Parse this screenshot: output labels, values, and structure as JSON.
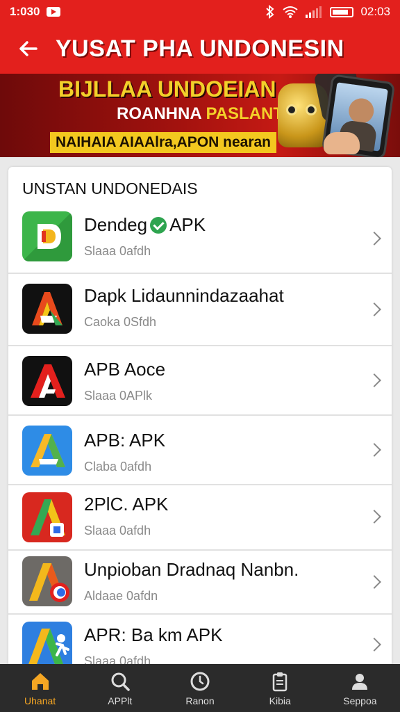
{
  "status_bar": {
    "time": "1:030",
    "clock": "02:03",
    "icons": [
      "youtube-icon",
      "bluetooth-icon",
      "wifi-icon",
      "signal-icon",
      "battery-icon"
    ]
  },
  "app_bar": {
    "title": "YUSAT PHA UNDONESIN",
    "back_icon": "arrow-left-icon"
  },
  "banner": {
    "headline": "BIJLLAA UNDOEIAN",
    "line2_white": "ROANHNA",
    "line2_yellow": "PASLANT",
    "strip": "NAIHAIA AIAAlra,APON nearan"
  },
  "section": {
    "title": "UNSTAN UNDONEDAIS"
  },
  "apps": [
    {
      "name": "Dendeg",
      "suffix": "APK",
      "verified": true,
      "subtitle": "Slaaa 0afdh",
      "icon": "green-d-app-icon"
    },
    {
      "name": "Dapk Lidaunnindazaahat",
      "suffix": "",
      "verified": false,
      "subtitle": "Caoka 0Sfdh",
      "icon": "black-multicolor-a-app-icon"
    },
    {
      "name": "APB Aoce",
      "suffix": "",
      "verified": false,
      "subtitle": "Slaaa 0APlk",
      "icon": "black-red-a-app-icon"
    },
    {
      "name": "APB: APK",
      "suffix": "",
      "verified": false,
      "subtitle": "Claba 0afdh",
      "icon": "blue-a-app-icon"
    },
    {
      "name": "2PlC. APK",
      "suffix": "",
      "verified": false,
      "subtitle": "Slaaa 0afdh",
      "icon": "red-green-a-app-icon"
    },
    {
      "name": "Unpioban Dradnaq Nanbn.",
      "suffix": "",
      "verified": false,
      "subtitle": "Aldaae 0afdn",
      "icon": "gray-yellow-a-app-icon"
    },
    {
      "name": "APR: Ba km APK",
      "suffix": "",
      "verified": false,
      "subtitle": "Slaaa 0afdh",
      "icon": "blue-a-runner-app-icon"
    }
  ],
  "bottom_nav": [
    {
      "label": "Uhanat",
      "icon": "home-icon",
      "active": true
    },
    {
      "label": "APPlt",
      "icon": "search-icon",
      "active": false
    },
    {
      "label": "Ranon",
      "icon": "clock-icon",
      "active": false
    },
    {
      "label": "Kibia",
      "icon": "clipboard-icon",
      "active": false
    },
    {
      "label": "Seppoa",
      "icon": "profile-icon",
      "active": false
    }
  ],
  "colors": {
    "brand_red": "#e3201d",
    "accent_yellow": "#f3d02a",
    "nav_bg": "#2b2b2b",
    "nav_active": "#f5a623"
  }
}
